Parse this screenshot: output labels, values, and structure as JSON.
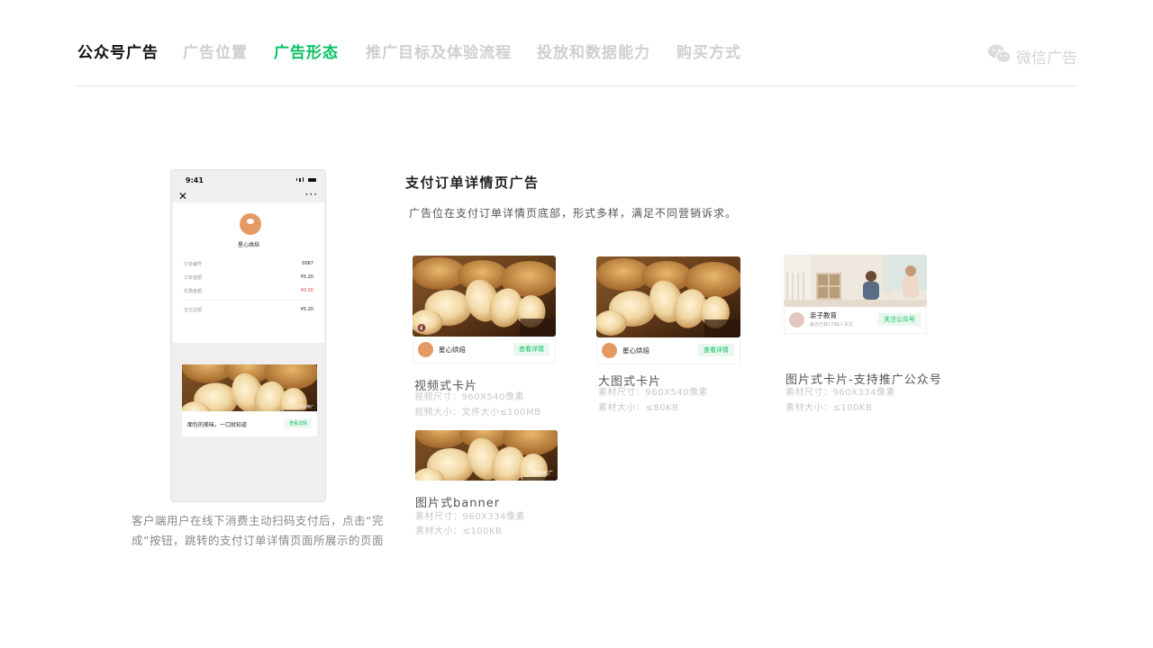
{
  "nav": {
    "tabs": [
      {
        "label": "公众号广告",
        "state": "title"
      },
      {
        "label": "广告位置",
        "state": "muted"
      },
      {
        "label": "广告形态",
        "state": "active"
      },
      {
        "label": "推广目标及体验流程",
        "state": "muted"
      },
      {
        "label": "投放和数据能力",
        "state": "muted"
      },
      {
        "label": "购买方式",
        "state": "muted"
      }
    ],
    "brand_label": "微信广告",
    "brand_icon": "wechat-icon"
  },
  "colors": {
    "accent": "#07c160",
    "muted": "#cfcfcf",
    "title": "#111111"
  },
  "phone": {
    "time": "9:41",
    "close_icon": "close-icon",
    "more_icon": "more-icon",
    "merchant": "星心烘焙",
    "rows": [
      {
        "label": "订单编号",
        "value": "0067"
      },
      {
        "label": "订单金额",
        "value": "¥5.20"
      },
      {
        "label": "优惠金额",
        "value": "¥0.00"
      },
      {
        "label": "支付总额",
        "value": "¥5.20"
      }
    ],
    "ad_text": "面包的美味，一口就知道",
    "ad_button": "查看详情",
    "ad_tag": "活动推广"
  },
  "caption": "客户端用户在线下消费主动扫码支付后，点击“完成”按钮，跳转的支付订单详情页面所展示的页面",
  "section": {
    "title": "支付订单详情页广告",
    "description": "广告位在支付订单详情页底部，形式多样，满足不同营销诉求。"
  },
  "ads": [
    {
      "key": "video",
      "merchant": "星心烘焙",
      "button": "查看详情",
      "name": "视频式卡片",
      "specs": [
        "视频尺寸：960X540像素",
        "视频大小：文件大小≤100MB"
      ]
    },
    {
      "key": "bigimage",
      "merchant": "星心烘焙",
      "button": "查看详情",
      "name": "大图式卡片",
      "specs": [
        "素材尺寸：960X540像素",
        "素材大小：≤80KB"
      ]
    },
    {
      "key": "imagecard",
      "merchant": "亲子教育",
      "merchant_sub": "最近已有1796人关注",
      "button": "关注公众号",
      "name": "图片式卡片-支持推广公众号",
      "specs": [
        "素材尺寸：960X334像素",
        "素材大小：≤100KB"
      ]
    },
    {
      "key": "banner",
      "tag": "活动推广",
      "name": "图片式banner",
      "specs": [
        "素材尺寸：960X334像素",
        "素材大小：≤100KB"
      ]
    }
  ]
}
